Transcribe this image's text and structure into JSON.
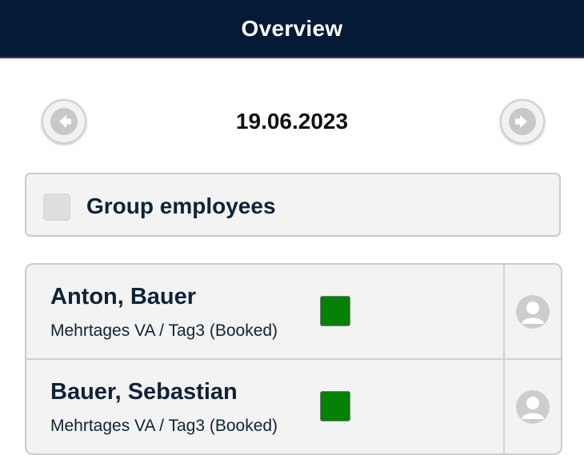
{
  "header": {
    "title": "Overview"
  },
  "date_nav": {
    "date": "19.06.2023",
    "prev_icon": "arrow-left-icon",
    "next_icon": "arrow-right-icon"
  },
  "group_toggle": {
    "label": "Group employees",
    "checked": false
  },
  "employees": [
    {
      "name": "Anton, Bauer",
      "status": "Mehrtages VA / Tag3 (Booked)",
      "status_color": "#058205",
      "avatar_icon": "user-avatar-icon"
    },
    {
      "name": "Bauer, Sebastian",
      "status": "Mehrtages VA / Tag3 (Booked)",
      "status_color": "#058205",
      "avatar_icon": "user-avatar-icon"
    }
  ],
  "colors": {
    "header_bg": "#041a36",
    "header_accent": "#6d2a55",
    "text_dark": "#0f2338",
    "panel_bg": "#f3f3f3",
    "booked_green": "#058205"
  }
}
